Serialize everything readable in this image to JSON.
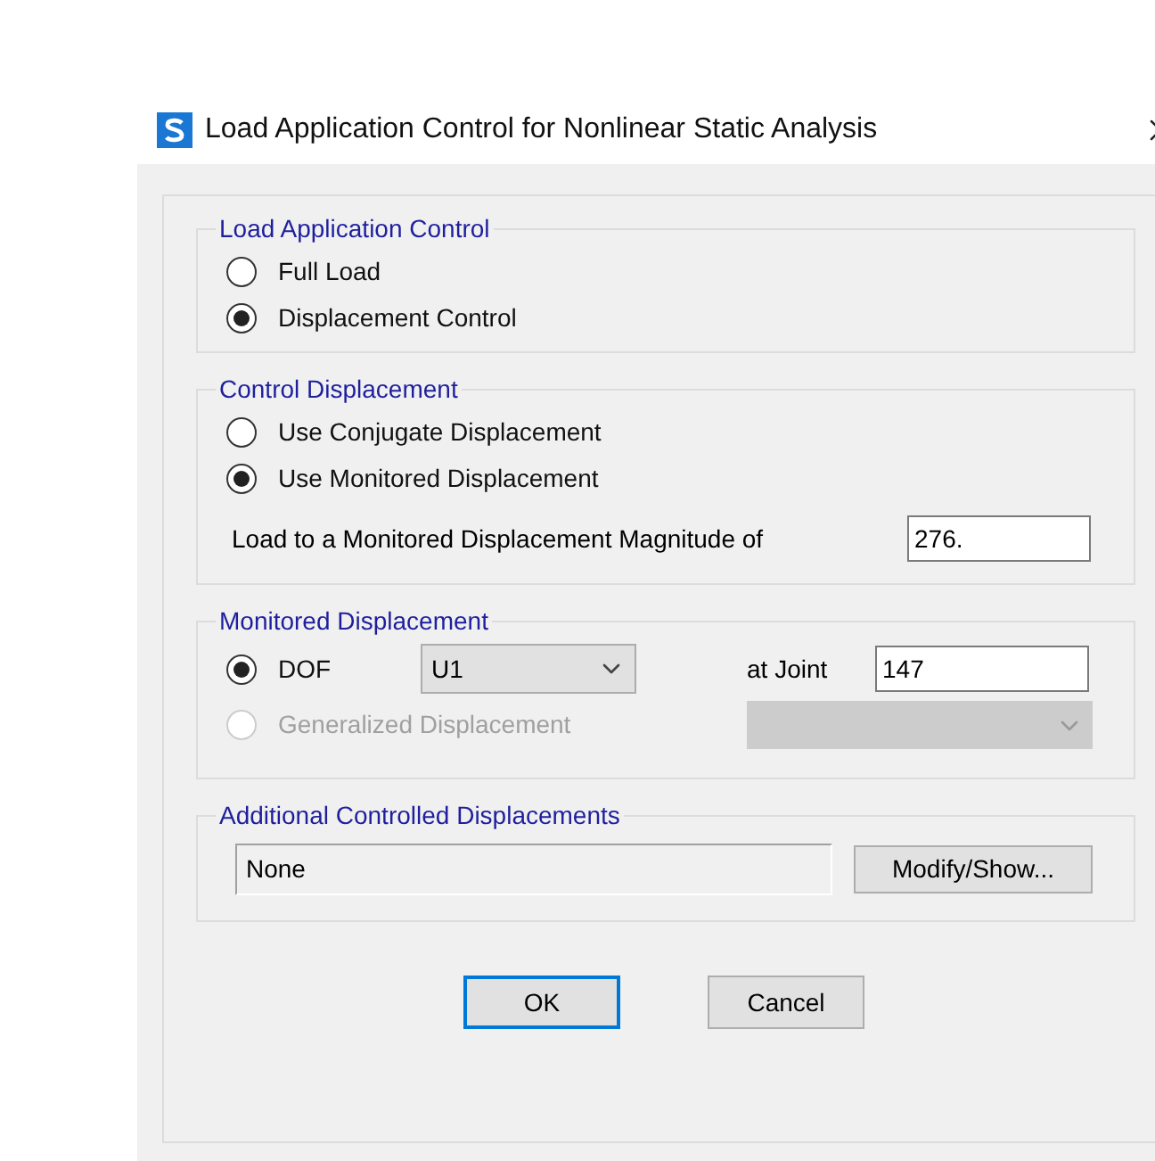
{
  "window": {
    "title": "Load Application Control for Nonlinear Static Analysis"
  },
  "load_application_control": {
    "title": "Load Application Control",
    "options": [
      {
        "label": "Full Load",
        "selected": false
      },
      {
        "label": "Displacement Control",
        "selected": true
      }
    ]
  },
  "control_displacement": {
    "title": "Control Displacement",
    "options": [
      {
        "label": "Use Conjugate Displacement",
        "selected": false
      },
      {
        "label": "Use Monitored Displacement",
        "selected": true
      }
    ],
    "magnitude": {
      "label": "Load to a Monitored Displacement Magnitude of",
      "value": "276."
    }
  },
  "monitored_displacement": {
    "title": "Monitored Displacement",
    "options": [
      {
        "label": "DOF",
        "selected": true,
        "disabled": false
      },
      {
        "label": "Generalized Displacement",
        "selected": false,
        "disabled": true
      }
    ],
    "dof_select": {
      "value": "U1"
    },
    "joint": {
      "label": "at Joint",
      "value": "147"
    },
    "generalized_select": {
      "disabled": true
    }
  },
  "additional_controlled_displacements": {
    "title": "Additional Controlled Displacements",
    "value": "None",
    "button": "Modify/Show..."
  },
  "buttons": [
    {
      "label": "OK",
      "default": true
    },
    {
      "label": "Cancel",
      "default": false
    }
  ]
}
